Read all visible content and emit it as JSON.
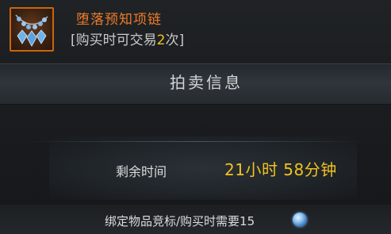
{
  "item": {
    "name": "堕落预知项链",
    "trade_prefix": "[购买时可交易",
    "trade_count": "2",
    "trade_suffix": "次]",
    "icon": "necklace-icon"
  },
  "auction": {
    "section_title": "拍卖信息",
    "remaining_label": "剩余时间",
    "remaining_value": "21小时 58分钟",
    "requirement_text": "绑定物品竞标/购买时需要15",
    "requirement_icon": "gem-icon"
  },
  "colors": {
    "item_name": "#ee7b28",
    "highlight": "#f0c21c",
    "text": "#dcdcdc"
  }
}
